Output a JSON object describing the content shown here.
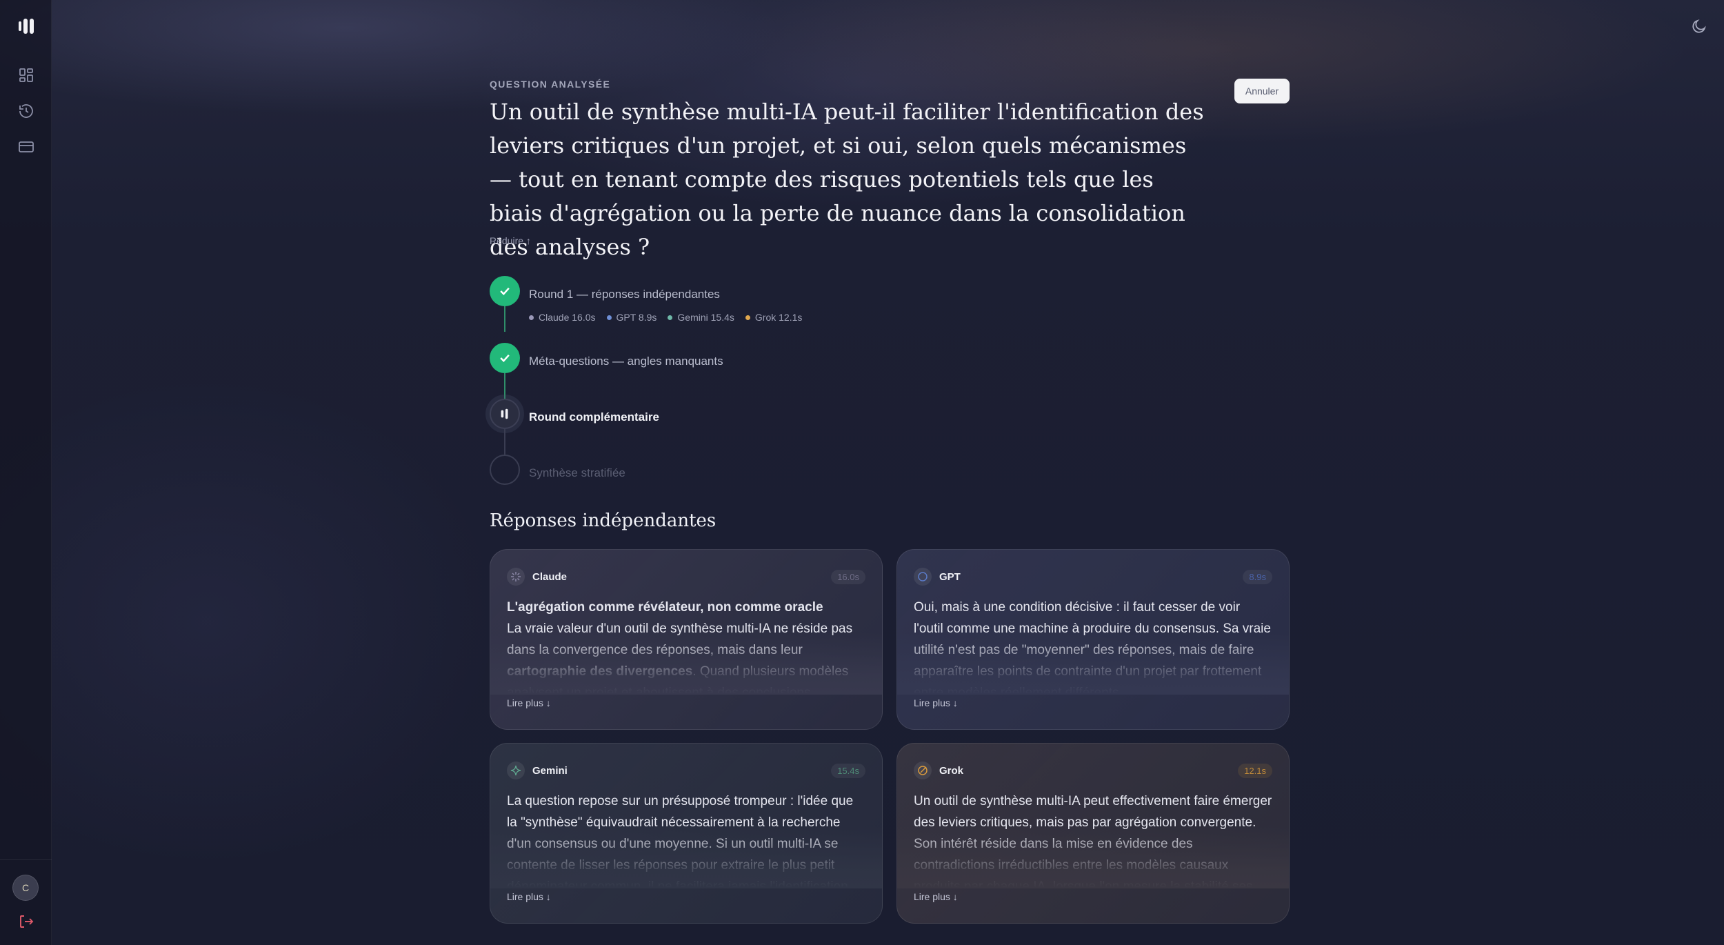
{
  "header": {
    "cancel_label": "Annuler"
  },
  "sidebar": {
    "icons": [
      "dashboard-icon",
      "history-icon",
      "billing-card-icon"
    ],
    "avatar_initial": "C"
  },
  "question": {
    "label": "QUESTION ANALYSÉE",
    "text": "Un outil de synthèse multi-IA peut-il faciliter l'identification des leviers critiques d'un projet, et si oui, selon quels mécanismes — tout en tenant compte des risques potentiels tels que les biais d'agrégation ou la perte de nuance dans la consolidation des analyses ?",
    "reduce_label": "Réduire ↑"
  },
  "steps": [
    {
      "label": "Round 1 — réponses indépendantes",
      "status": "done"
    },
    {
      "label": "Méta-questions — angles manquants",
      "status": "done"
    },
    {
      "label": "Round complémentaire",
      "status": "active"
    },
    {
      "label": "Synthèse stratifiée",
      "status": "pending"
    }
  ],
  "timings": [
    {
      "label": "Claude 16.0s",
      "color": "#9a98b8"
    },
    {
      "label": "GPT 8.9s",
      "color": "#6f8fd6"
    },
    {
      "label": "Gemini 15.4s",
      "color": "#6fb8a8"
    },
    {
      "label": "Grok 12.1s",
      "color": "#e0a84f"
    }
  ],
  "section_title": "Réponses indépendantes",
  "cards": {
    "claude": {
      "name": "Claude",
      "time": "16.0s",
      "color": "#8a87a6",
      "heading": "L'agrégation comme révélateur, non comme oracle",
      "text_before": "La vraie valeur d'un outil de synthèse multi-IA ne réside pas dans la convergence des réponses, mais dans leur ",
      "bold": "cartographie des divergences",
      "text_after": ". Quand plusieurs modèles analysent un projet et aboutissent à des conclusions",
      "read_more": "Lire plus ↓"
    },
    "gpt": {
      "name": "GPT",
      "time": "8.9s",
      "color": "#5b7bc8",
      "text": "Oui, mais à une condition décisive : il faut cesser de voir l'outil comme une machine à produire du consensus. Sa vraie utilité n'est pas de \"moyenner\" des réponses, mais de faire apparaître les points de contrainte d'un projet par frottement entre modèles réellement différents.",
      "read_more": "Lire plus ↓"
    },
    "gemini": {
      "name": "Gemini",
      "time": "15.4s",
      "color": "#5fa890",
      "text": "La question repose sur un présupposé trompeur : l'idée que la \"synthèse\" équivaudrait nécessairement à la recherche d'un consensus ou d'une moyenne. Si un outil multi-IA se contente de lisser les réponses pour extraire le plus petit dénominateur commun, il ne facilitera jamais l'identification",
      "read_more": "Lire plus ↓"
    },
    "grok": {
      "name": "Grok",
      "time": "12.1s",
      "color": "#d89a3e",
      "text": "Un outil de synthèse multi-IA peut effectivement faire émerger des leviers critiques, mais pas par agrégation convergente. Son intérêt réside dans la mise en évidence des contradictions irréductibles entre les modèles causaux produits par chaque IA, lorsque l'on mesure la stabilité ses",
      "read_more": "Lire plus ↓"
    }
  }
}
